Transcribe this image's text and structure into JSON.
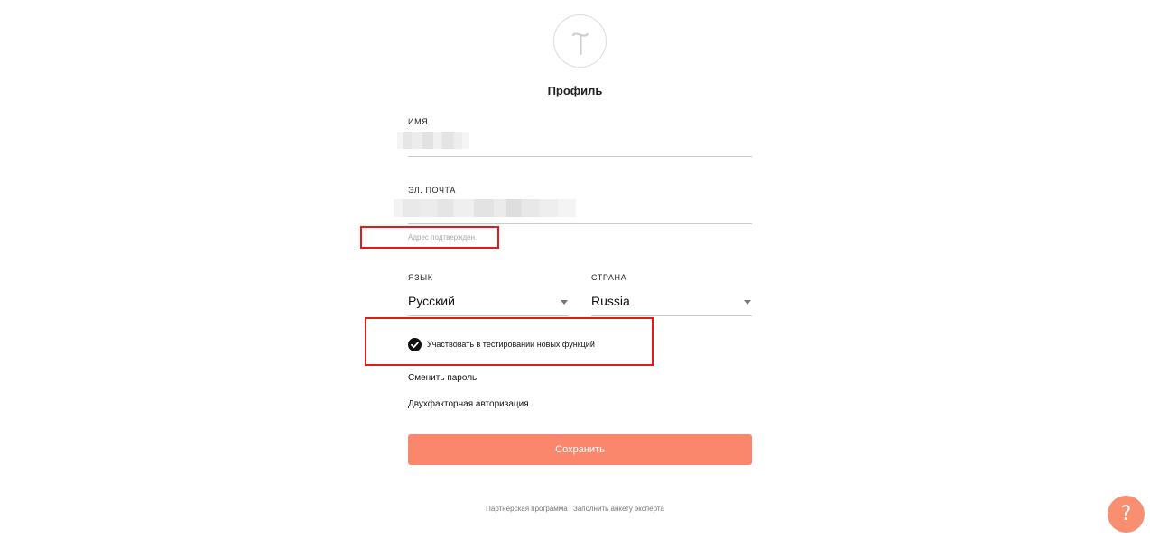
{
  "header": {
    "logo_icon": "tilda-logo-icon",
    "title": "Профиль"
  },
  "form": {
    "name": {
      "label": "ИМЯ",
      "value_redacted": true
    },
    "email": {
      "label": "ЭЛ. ПОЧТА",
      "value_redacted": true,
      "status_hint": "Адрес подтвержден."
    },
    "language": {
      "label": "ЯЗЫК",
      "selected": "Русский"
    },
    "country": {
      "label": "СТРАНА",
      "selected": "Russia"
    },
    "beta_checkbox": {
      "label": "Участвовать в тестировании новых функций",
      "checked": true
    },
    "links": {
      "change_password": "Сменить пароль",
      "two_factor": "Двухфакторная авторизация"
    },
    "save_label": "Сохранить"
  },
  "footer": {
    "partner_program": "Партнерская программа",
    "expert_form": "Заполнить анкету эксперта"
  },
  "help": {
    "icon": "question-mark-icon",
    "glyph": "?"
  },
  "colors": {
    "accent": "#fa876b",
    "help_button": "#f88f71",
    "annotation": "#e01b1b"
  }
}
